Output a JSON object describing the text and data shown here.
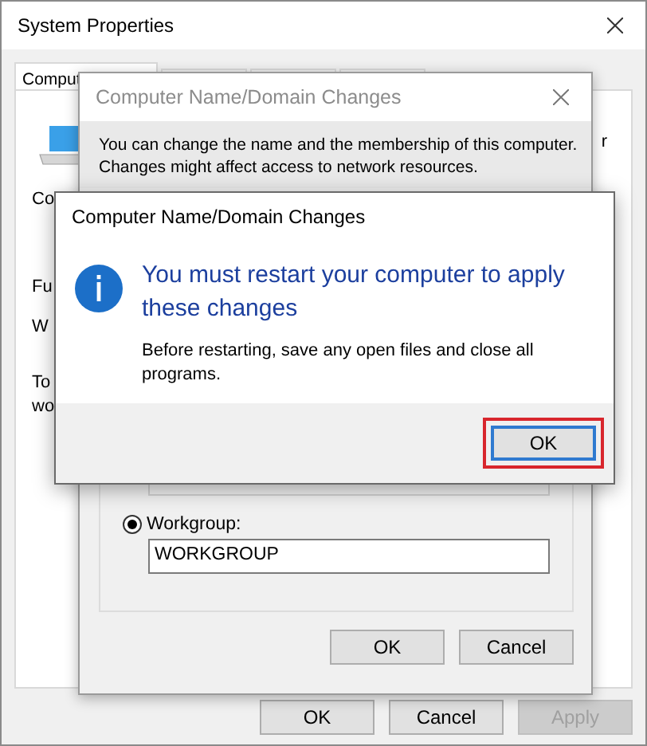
{
  "system_properties": {
    "title": "System Properties",
    "tabs": [
      {
        "label": "Comput",
        "selected": true
      },
      {
        "selected": false
      },
      {
        "selected": false
      },
      {
        "selected": false
      }
    ],
    "panel_fragments": [
      "Co",
      "Fu",
      "W",
      "To",
      "wo"
    ],
    "right_fragment": "r",
    "buttons": [
      {
        "label": "OK",
        "disabled": false
      },
      {
        "label": "Cancel",
        "disabled": false
      },
      {
        "label": "Apply",
        "disabled": true
      }
    ]
  },
  "name_changes": {
    "title": "Computer Name/Domain Changes",
    "description": "You can change the name and the membership of this computer. Changes might affect access to network resources.",
    "workgroup_option": {
      "label": "Workgroup:",
      "selected": true
    },
    "workgroup_value": "WORKGROUP",
    "buttons": [
      {
        "label": "OK",
        "disabled": false
      },
      {
        "label": "Cancel",
        "disabled": false
      }
    ]
  },
  "restart_dialog": {
    "title": "Computer Name/Domain Changes",
    "instruction": "You must restart your computer to apply these changes",
    "body": "Before restarting, save any open files and close all programs.",
    "button": {
      "label": "OK",
      "highlighted": true
    }
  }
}
